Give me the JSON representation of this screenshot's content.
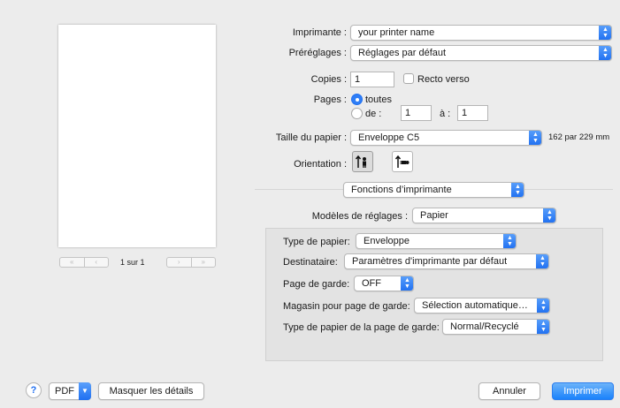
{
  "preview": {
    "page_label": "1 sur 1",
    "first_glyph": "«",
    "prev_glyph": "‹",
    "next_glyph": "›",
    "last_glyph": "»"
  },
  "printer": {
    "label": "Imprimante :",
    "value": "your printer name"
  },
  "presets": {
    "label": "Préréglages :",
    "value": "Réglages par défaut"
  },
  "copies": {
    "label": "Copies :",
    "value": "1",
    "duplex_label": "Recto verso"
  },
  "pages": {
    "label": "Pages :",
    "all_label": "toutes",
    "from_label": "de :",
    "from_value": "1",
    "to_label": "à :",
    "to_value": "1"
  },
  "paper_size": {
    "label": "Taille du papier :",
    "value": "Enveloppe C5",
    "dimensions": "162 par 229 mm"
  },
  "orientation": {
    "label": "Orientation :"
  },
  "section": {
    "value": "Fonctions d’imprimante"
  },
  "feature_sets": {
    "label": "Modèles de réglages :",
    "value": "Papier"
  },
  "options": [
    {
      "label": "Type de papier:",
      "value": "Enveloppe"
    },
    {
      "label": "Destinataire:",
      "value": "Paramètres d'imprimante par défaut"
    },
    {
      "label": "Page de garde:",
      "value": "OFF"
    },
    {
      "label": "Magasin pour page de garde:",
      "value": "Sélection automatique d..."
    },
    {
      "label": "Type de papier de la page de garde:",
      "value": "Normal/Recyclé"
    }
  ],
  "footer": {
    "help": "?",
    "pdf": "PDF",
    "hide_details": "Masquer les détails",
    "cancel": "Annuler",
    "print": "Imprimer"
  },
  "colors": {
    "accent": "#1f6ff1",
    "window": "#ececec"
  }
}
